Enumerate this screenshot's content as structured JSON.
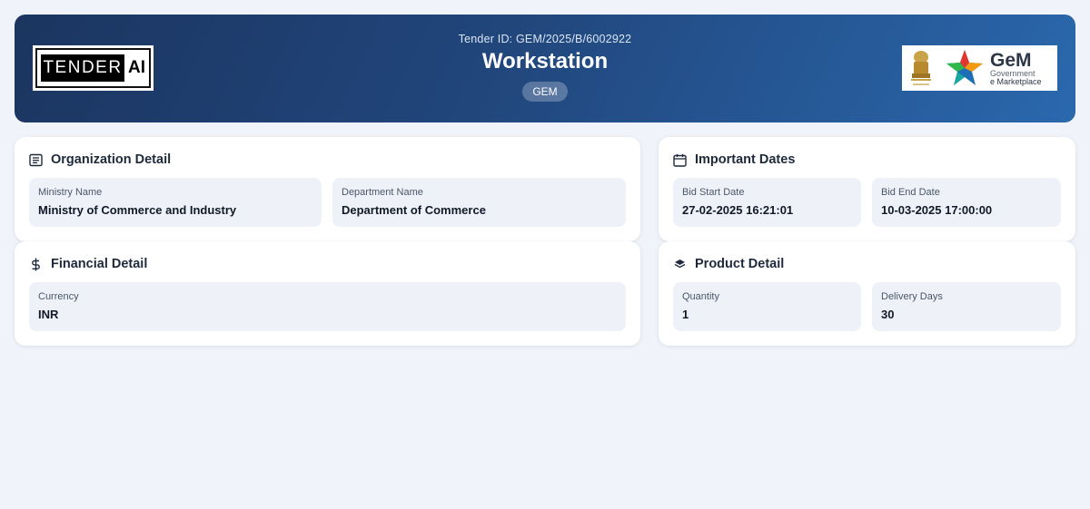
{
  "header": {
    "tender_id": "Tender ID: GEM/2025/B/6002922",
    "title": "Workstation",
    "badge": "GEM",
    "left_logo": {
      "word1": "TENDER",
      "word2": "AI"
    },
    "right_logo": {
      "name": "GeM",
      "line1": "Government",
      "line2": "e Marketplace"
    }
  },
  "cards": {
    "organization": {
      "title": "Organization Detail",
      "icon": "document-icon",
      "fields": [
        {
          "label": "Ministry Name",
          "value": "Ministry of Commerce and Industry"
        },
        {
          "label": "Department Name",
          "value": "Department of Commerce"
        }
      ]
    },
    "dates": {
      "title": "Important Dates",
      "icon": "calendar-icon",
      "fields": [
        {
          "label": "Bid Start Date",
          "value": "27-02-2025 16:21:01"
        },
        {
          "label": "Bid End Date",
          "value": "10-03-2025 17:00:00"
        }
      ]
    },
    "financial": {
      "title": "Financial Detail",
      "icon": "dollar-icon",
      "fields": [
        {
          "label": "Currency",
          "value": "INR"
        }
      ]
    },
    "product": {
      "title": "Product Detail",
      "icon": "layers-icon",
      "fields": [
        {
          "label": "Quantity",
          "value": "1"
        },
        {
          "label": "Delivery Days",
          "value": "30"
        }
      ]
    }
  },
  "colors": {
    "background": "#f0f3f9",
    "header_gradient_start": "#1b3560",
    "header_gradient_end": "#2a68ad",
    "field_background": "#eef2f8"
  }
}
